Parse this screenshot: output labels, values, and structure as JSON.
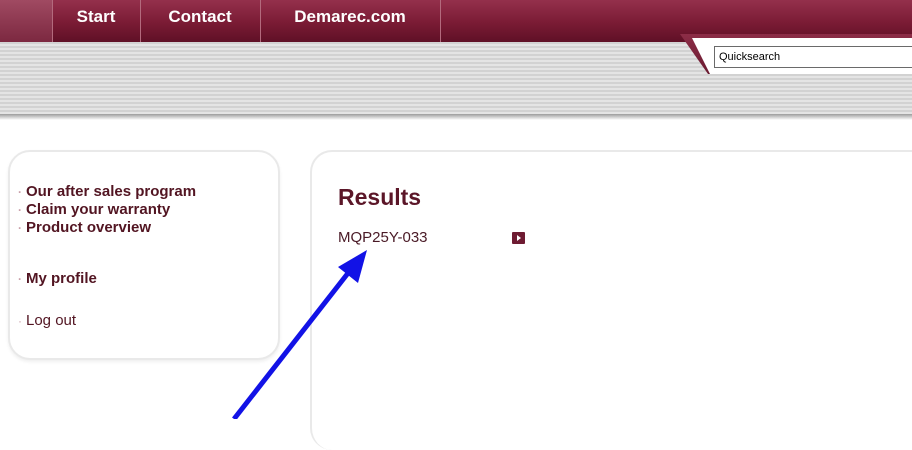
{
  "nav": {
    "items": [
      "Start",
      "Contact",
      "Demarec.com"
    ]
  },
  "search": {
    "value": "Quicksearch"
  },
  "sidebar": {
    "items": [
      {
        "label": "Our after sales program"
      },
      {
        "label": "Claim your warranty"
      },
      {
        "label": "Product overview"
      },
      {
        "label": "My profile"
      },
      {
        "label": "Log out"
      }
    ]
  },
  "results": {
    "title": "Results",
    "items": [
      {
        "code": "MQP25Y-033"
      }
    ]
  },
  "colors": {
    "brand": "#7a1b34",
    "annotation_arrow": "#1212e6"
  },
  "icons": {
    "result_open": "play-arrow-icon",
    "annotation": "pointer-arrow-icon"
  }
}
